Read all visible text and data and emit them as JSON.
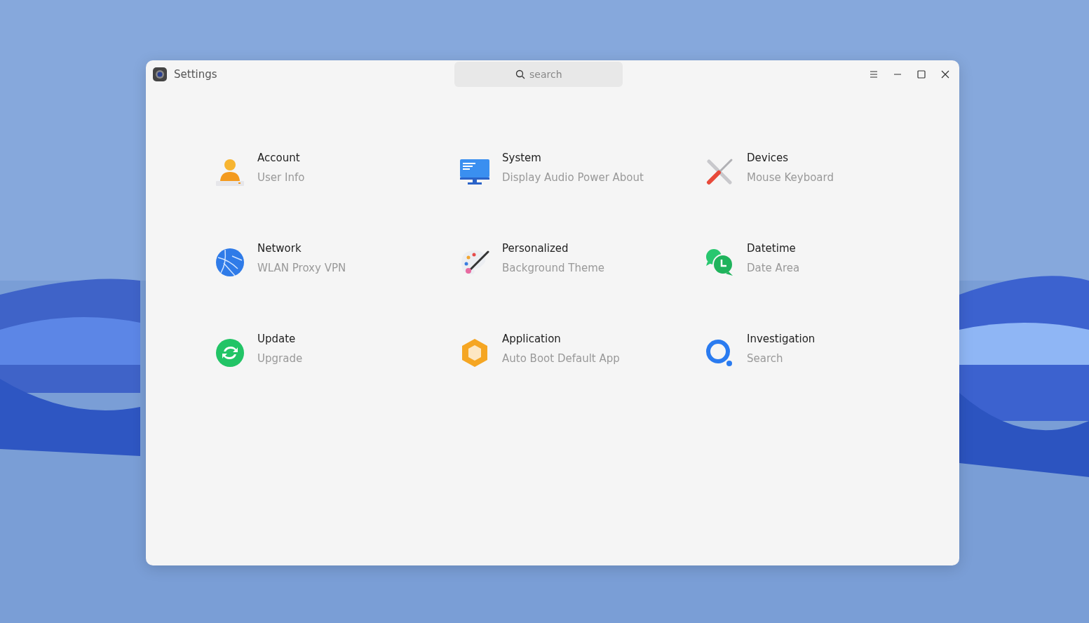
{
  "window": {
    "title": "Settings"
  },
  "search": {
    "placeholder": "search"
  },
  "categories": [
    {
      "kind": "account",
      "title": "Account",
      "subtitle": "User Info"
    },
    {
      "kind": "system",
      "title": "System",
      "subtitle": "Display Audio Power About"
    },
    {
      "kind": "devices",
      "title": "Devices",
      "subtitle": "Mouse Keyboard"
    },
    {
      "kind": "network",
      "title": "Network",
      "subtitle": "WLAN Proxy VPN"
    },
    {
      "kind": "personalized",
      "title": "Personalized",
      "subtitle": "Background Theme"
    },
    {
      "kind": "datetime",
      "title": "Datetime",
      "subtitle": "Date Area"
    },
    {
      "kind": "update",
      "title": "Update",
      "subtitle": "Upgrade"
    },
    {
      "kind": "application",
      "title": "Application",
      "subtitle": "Auto Boot Default App"
    },
    {
      "kind": "investigation",
      "title": "Investigation",
      "subtitle": "Search"
    }
  ]
}
